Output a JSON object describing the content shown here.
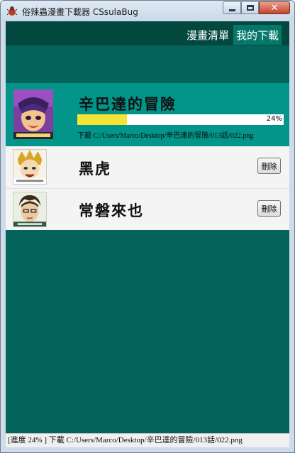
{
  "window": {
    "title": "俗辣蟲漫畫下載器 CSsulaBug",
    "close_glyph": "✕"
  },
  "tabs": [
    {
      "label": "漫畫清單",
      "active": false
    },
    {
      "label": "我的下載",
      "active": true
    }
  ],
  "downloads": [
    {
      "title": "辛巴達的冒險",
      "progress_percent": 24,
      "progress_label": "24%",
      "status": "下載 C:/Users/Marco/Desktop/辛巴達的冒險/013話/022.png",
      "cover_icon": "sinbad-cover-thumbnail"
    },
    {
      "title": "黑虎",
      "delete_label": "刪除",
      "cover_icon": "black-tiger-cover-thumbnail"
    },
    {
      "title": "常磐來也",
      "delete_label": "刪除",
      "cover_icon": "tokiwa-cover-thumbnail"
    }
  ],
  "statusbar": {
    "text": "[進度 24% ] 下載 C:/Users/Marco/Desktop/辛巴達的冒險/013話/022.png"
  },
  "colors": {
    "content_bg": "#04635a",
    "topbar_bg": "#03483f",
    "active_tab_bg": "#05776b",
    "active_row_bg": "#03948a",
    "progress_fill": "#f5e335"
  }
}
